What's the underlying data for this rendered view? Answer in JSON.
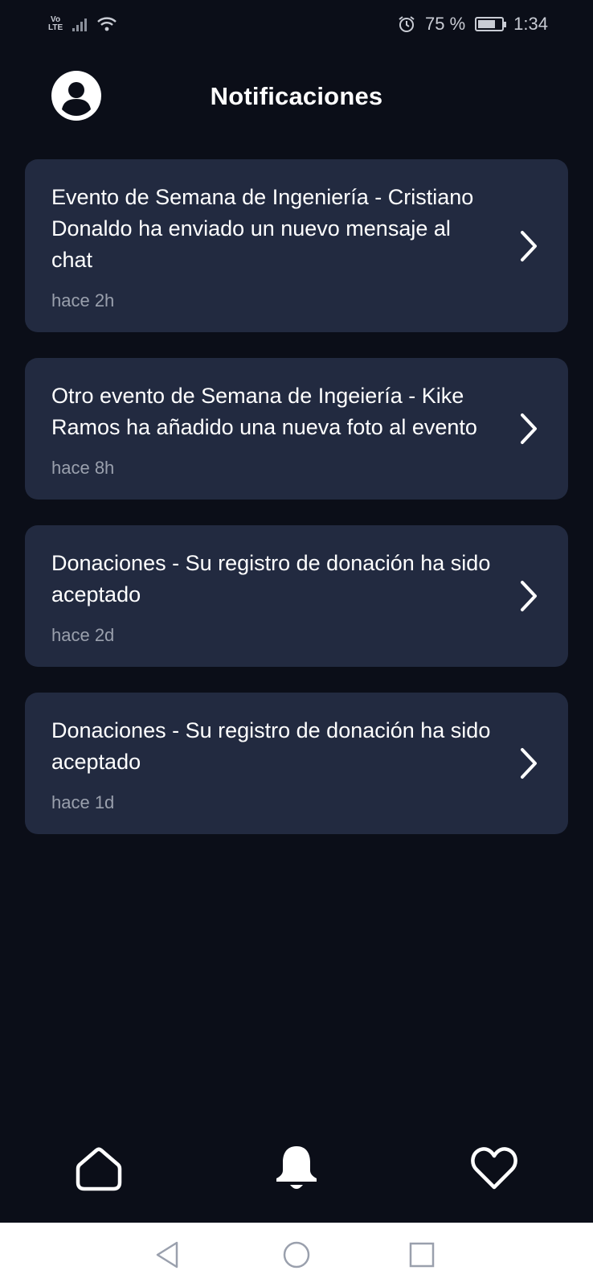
{
  "status_bar": {
    "volte_top": "Vo",
    "volte_bottom": "LTE",
    "battery_percent": "75 %",
    "battery_level": 0.75,
    "time": "1:34"
  },
  "header": {
    "title": "Notificaciones",
    "profile_icon": "account-circle-icon"
  },
  "notifications": [
    {
      "text": "Evento de Semana de Ingeniería - Cristiano Donaldo ha enviado un nuevo mensaje al chat",
      "time": "hace 2h"
    },
    {
      "text": "Otro evento de Semana de Ingeiería - Kike Ramos ha añadido una nueva foto al evento",
      "time": "hace 8h"
    },
    {
      "text": "Donaciones - Su registro de donación ha sido aceptado",
      "time": "hace 2d"
    },
    {
      "text": "Donaciones - Su registro de donación ha sido aceptado",
      "time": "hace 1d"
    }
  ],
  "bottom_nav": {
    "items": [
      {
        "icon": "home-icon",
        "active": false
      },
      {
        "icon": "bell-icon",
        "active": true
      },
      {
        "icon": "heart-icon",
        "active": false
      }
    ]
  },
  "colors": {
    "background": "#0b0e18",
    "card": "#222a40",
    "text": "#ffffff",
    "secondary_text": "#9aa0ad"
  }
}
